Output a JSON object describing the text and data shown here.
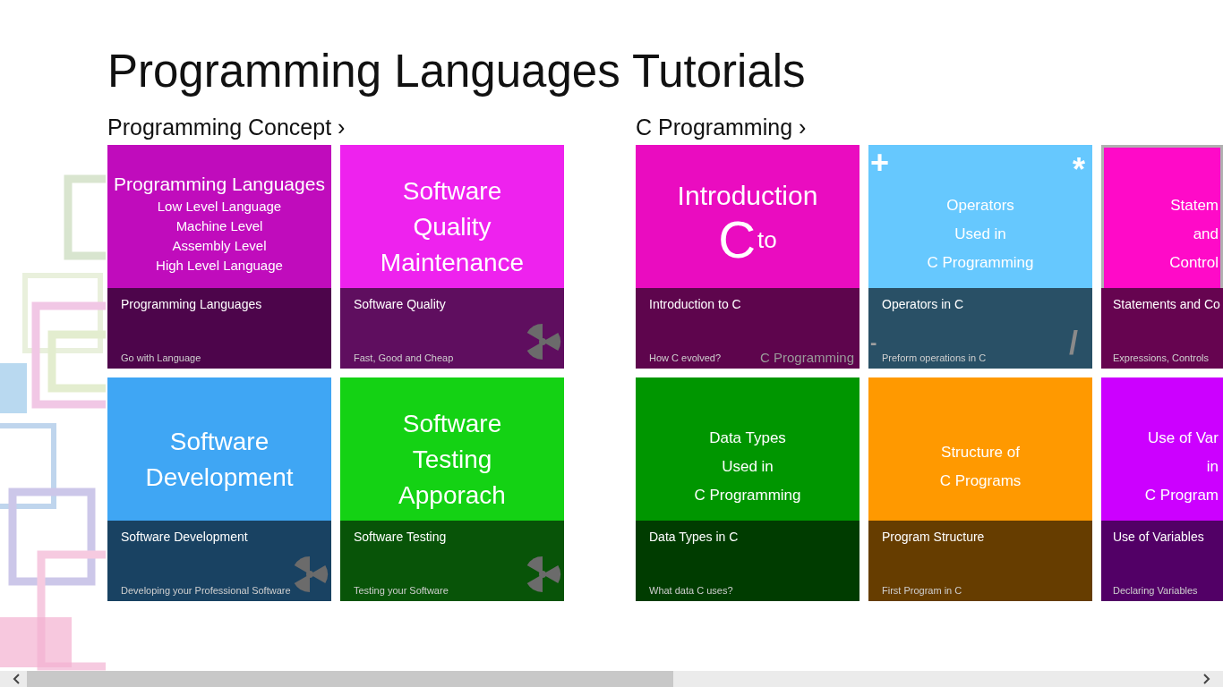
{
  "title": "Programming Languages Tutorials",
  "groups": [
    {
      "header": "Programming Concept",
      "chevron": "›",
      "tiles": [
        {
          "color": "#c00cbc",
          "selected": false,
          "kind": "plain",
          "art": {
            "kind": "list",
            "lines": [
              "Programming Languages",
              "Low Level Language",
              "Machine Level",
              "Assembly Level",
              "High Level Language"
            ]
          },
          "title": "Programming Languages",
          "subtitle": "Go with Language"
        },
        {
          "color": "#3fa6f4",
          "selected": false,
          "kind": "emblem",
          "art": {
            "kind": "large",
            "lines": [
              "Software",
              "Development"
            ]
          },
          "title": "Software Development",
          "subtitle": "Developing your Professional Software"
        },
        {
          "color": "#ee22ee",
          "selected": false,
          "kind": "emblem",
          "art": {
            "kind": "large",
            "lines": [
              "Software",
              "Quality",
              "Maintenance"
            ]
          },
          "title": "Software Quality",
          "subtitle": "Fast, Good and Cheap"
        },
        {
          "color": "#14d214",
          "selected": false,
          "kind": "emblem",
          "art": {
            "kind": "large",
            "lines": [
              "Software",
              "Testing",
              "Apporach"
            ]
          },
          "title": "Software Testing",
          "subtitle": "Testing your Software"
        }
      ]
    },
    {
      "header": "C Programming",
      "chevron": "›",
      "tiles": [
        {
          "color": "#ea0cc0",
          "selected": false,
          "kind": "plain",
          "art": {
            "kind": "intro",
            "lines": [
              "Introduction",
              "C",
              "to",
              "C Programming"
            ]
          },
          "title": "Introduction to C",
          "subtitle": "How C evolved?"
        },
        {
          "color": "#009600",
          "selected": false,
          "kind": "plain",
          "art": {
            "kind": "small",
            "lines": [
              "Data Types",
              "Used in",
              "C Programming"
            ]
          },
          "title": "Data Types in C",
          "subtitle": "What data C uses?"
        },
        {
          "color": "#66c8fe",
          "selected": false,
          "kind": "operators",
          "art": {
            "kind": "small",
            "lines": [
              "Operators",
              "Used in",
              "C Programming"
            ]
          },
          "title": "Operators in C",
          "subtitle": "Preform operations in C",
          "corners": [
            "+",
            "*",
            "/",
            "-"
          ]
        },
        {
          "color": "#ff9900",
          "selected": false,
          "kind": "plain",
          "art": {
            "kind": "small",
            "lines": [
              "Structure of",
              "C Programs"
            ]
          },
          "title": "Program Structure",
          "subtitle": "First Program in C"
        },
        {
          "color": "#ff0ac8",
          "selected": true,
          "kind": "plain",
          "art": {
            "kind": "small",
            "lines": [
              "Statem",
              "and",
              "Control"
            ]
          },
          "title": "Statements and Co",
          "subtitle": "Expressions, Controls"
        },
        {
          "color": "#cc00ff",
          "selected": false,
          "kind": "plain",
          "art": {
            "kind": "small",
            "lines": [
              "Use of Var",
              "in",
              "C Program"
            ]
          },
          "title": "Use of Variables",
          "subtitle": "Declaring Variables"
        }
      ]
    }
  ]
}
